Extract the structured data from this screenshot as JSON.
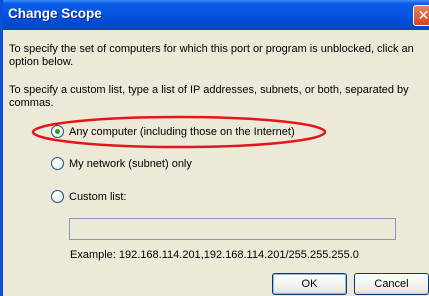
{
  "window": {
    "title": "Change Scope",
    "close_glyph": "✕"
  },
  "instructions": {
    "line1": "To specify the set of computers for which this port or program is unblocked, click an option below.",
    "line2": "To specify a custom list, type a list of IP addresses, subnets, or both, separated by commas."
  },
  "options": {
    "any": "Any computer (including those on the Internet)",
    "network": "My network (subnet) only",
    "custom": "Custom list:",
    "selected": "any"
  },
  "custom_list": {
    "value": ""
  },
  "example": "Example: 192.168.114.201,192.168.114.201/255.255.255.0",
  "buttons": {
    "ok": "OK",
    "cancel": "Cancel"
  },
  "annotation_color": "#e4141b"
}
